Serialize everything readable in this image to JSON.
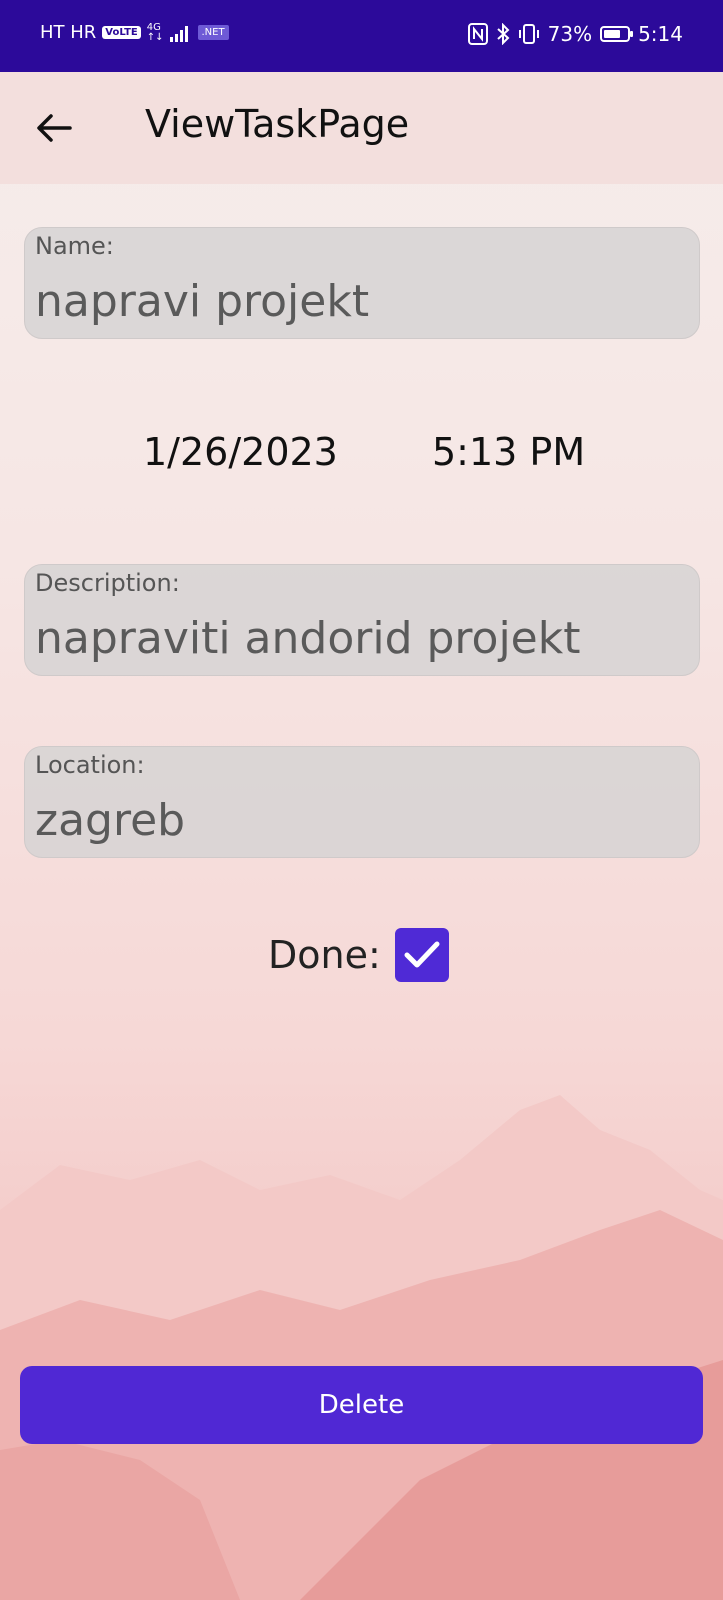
{
  "status_bar": {
    "carrier": "HT HR",
    "volte": "VoLTE",
    "network_top": "4G",
    "network_bottom": "↑↓",
    "dotnet": ".NET",
    "battery_percent": "73%",
    "battery_level": 0.73,
    "time": "5:14"
  },
  "app_bar": {
    "title": "ViewTaskPage"
  },
  "fields": {
    "name": {
      "label": "Name:",
      "value": "napravi projekt"
    },
    "description": {
      "label": "Description:",
      "value": "napraviti andorid projekt"
    },
    "location": {
      "label": "Location:",
      "value": "zagreb"
    }
  },
  "datetime": {
    "date": "1/26/2023",
    "time": "5:13 PM"
  },
  "done": {
    "label": "Done:",
    "checked": true
  },
  "delete_button": {
    "label": "Delete"
  },
  "colors": {
    "status_bar": "#2c0a9a",
    "app_bar": "#f3dfdd",
    "accent": "#5028d4"
  }
}
